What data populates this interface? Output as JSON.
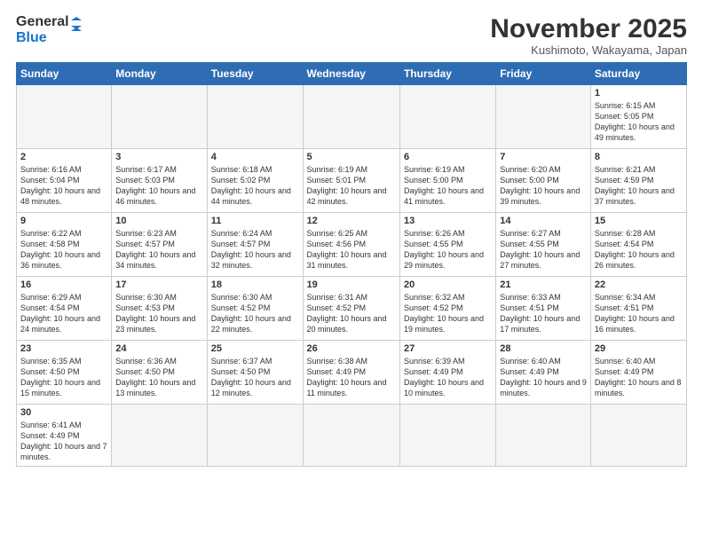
{
  "logo": {
    "text_general": "General",
    "text_blue": "Blue"
  },
  "title": "November 2025",
  "location": "Kushimoto, Wakayama, Japan",
  "weekdays": [
    "Sunday",
    "Monday",
    "Tuesday",
    "Wednesday",
    "Thursday",
    "Friday",
    "Saturday"
  ],
  "weeks": [
    [
      {
        "day": "",
        "info": ""
      },
      {
        "day": "",
        "info": ""
      },
      {
        "day": "",
        "info": ""
      },
      {
        "day": "",
        "info": ""
      },
      {
        "day": "",
        "info": ""
      },
      {
        "day": "",
        "info": ""
      },
      {
        "day": "1",
        "info": "Sunrise: 6:15 AM\nSunset: 5:05 PM\nDaylight: 10 hours and 49 minutes."
      }
    ],
    [
      {
        "day": "2",
        "info": "Sunrise: 6:16 AM\nSunset: 5:04 PM\nDaylight: 10 hours and 48 minutes."
      },
      {
        "day": "3",
        "info": "Sunrise: 6:17 AM\nSunset: 5:03 PM\nDaylight: 10 hours and 46 minutes."
      },
      {
        "day": "4",
        "info": "Sunrise: 6:18 AM\nSunset: 5:02 PM\nDaylight: 10 hours and 44 minutes."
      },
      {
        "day": "5",
        "info": "Sunrise: 6:19 AM\nSunset: 5:01 PM\nDaylight: 10 hours and 42 minutes."
      },
      {
        "day": "6",
        "info": "Sunrise: 6:19 AM\nSunset: 5:00 PM\nDaylight: 10 hours and 41 minutes."
      },
      {
        "day": "7",
        "info": "Sunrise: 6:20 AM\nSunset: 5:00 PM\nDaylight: 10 hours and 39 minutes."
      },
      {
        "day": "8",
        "info": "Sunrise: 6:21 AM\nSunset: 4:59 PM\nDaylight: 10 hours and 37 minutes."
      }
    ],
    [
      {
        "day": "9",
        "info": "Sunrise: 6:22 AM\nSunset: 4:58 PM\nDaylight: 10 hours and 36 minutes."
      },
      {
        "day": "10",
        "info": "Sunrise: 6:23 AM\nSunset: 4:57 PM\nDaylight: 10 hours and 34 minutes."
      },
      {
        "day": "11",
        "info": "Sunrise: 6:24 AM\nSunset: 4:57 PM\nDaylight: 10 hours and 32 minutes."
      },
      {
        "day": "12",
        "info": "Sunrise: 6:25 AM\nSunset: 4:56 PM\nDaylight: 10 hours and 31 minutes."
      },
      {
        "day": "13",
        "info": "Sunrise: 6:26 AM\nSunset: 4:55 PM\nDaylight: 10 hours and 29 minutes."
      },
      {
        "day": "14",
        "info": "Sunrise: 6:27 AM\nSunset: 4:55 PM\nDaylight: 10 hours and 27 minutes."
      },
      {
        "day": "15",
        "info": "Sunrise: 6:28 AM\nSunset: 4:54 PM\nDaylight: 10 hours and 26 minutes."
      }
    ],
    [
      {
        "day": "16",
        "info": "Sunrise: 6:29 AM\nSunset: 4:54 PM\nDaylight: 10 hours and 24 minutes."
      },
      {
        "day": "17",
        "info": "Sunrise: 6:30 AM\nSunset: 4:53 PM\nDaylight: 10 hours and 23 minutes."
      },
      {
        "day": "18",
        "info": "Sunrise: 6:30 AM\nSunset: 4:52 PM\nDaylight: 10 hours and 22 minutes."
      },
      {
        "day": "19",
        "info": "Sunrise: 6:31 AM\nSunset: 4:52 PM\nDaylight: 10 hours and 20 minutes."
      },
      {
        "day": "20",
        "info": "Sunrise: 6:32 AM\nSunset: 4:52 PM\nDaylight: 10 hours and 19 minutes."
      },
      {
        "day": "21",
        "info": "Sunrise: 6:33 AM\nSunset: 4:51 PM\nDaylight: 10 hours and 17 minutes."
      },
      {
        "day": "22",
        "info": "Sunrise: 6:34 AM\nSunset: 4:51 PM\nDaylight: 10 hours and 16 minutes."
      }
    ],
    [
      {
        "day": "23",
        "info": "Sunrise: 6:35 AM\nSunset: 4:50 PM\nDaylight: 10 hours and 15 minutes."
      },
      {
        "day": "24",
        "info": "Sunrise: 6:36 AM\nSunset: 4:50 PM\nDaylight: 10 hours and 13 minutes."
      },
      {
        "day": "25",
        "info": "Sunrise: 6:37 AM\nSunset: 4:50 PM\nDaylight: 10 hours and 12 minutes."
      },
      {
        "day": "26",
        "info": "Sunrise: 6:38 AM\nSunset: 4:49 PM\nDaylight: 10 hours and 11 minutes."
      },
      {
        "day": "27",
        "info": "Sunrise: 6:39 AM\nSunset: 4:49 PM\nDaylight: 10 hours and 10 minutes."
      },
      {
        "day": "28",
        "info": "Sunrise: 6:40 AM\nSunset: 4:49 PM\nDaylight: 10 hours and 9 minutes."
      },
      {
        "day": "29",
        "info": "Sunrise: 6:40 AM\nSunset: 4:49 PM\nDaylight: 10 hours and 8 minutes."
      }
    ],
    [
      {
        "day": "30",
        "info": "Sunrise: 6:41 AM\nSunset: 4:49 PM\nDaylight: 10 hours and 7 minutes."
      },
      {
        "day": "",
        "info": ""
      },
      {
        "day": "",
        "info": ""
      },
      {
        "day": "",
        "info": ""
      },
      {
        "day": "",
        "info": ""
      },
      {
        "day": "",
        "info": ""
      },
      {
        "day": "",
        "info": ""
      }
    ]
  ]
}
